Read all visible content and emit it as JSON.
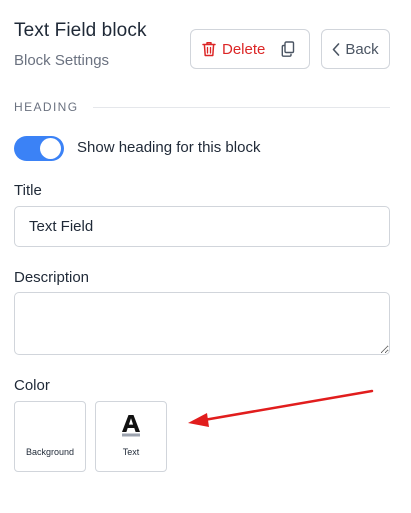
{
  "header": {
    "title": "Text Field block",
    "subtitle": "Block Settings",
    "delete_label": "Delete",
    "back_label": "Back"
  },
  "heading_section": {
    "label": "HEADING",
    "toggle_label": "Show heading for this block",
    "toggle_on": true
  },
  "title_field": {
    "label": "Title",
    "value": "Text Field"
  },
  "description_field": {
    "label": "Description",
    "value": ""
  },
  "color_section": {
    "label": "Color",
    "swatches": [
      {
        "label": "Background"
      },
      {
        "label": "Text"
      }
    ]
  },
  "colors": {
    "accent": "#3b82f6",
    "danger": "#dc2626",
    "annotation_arrow": "#e11d1d"
  }
}
